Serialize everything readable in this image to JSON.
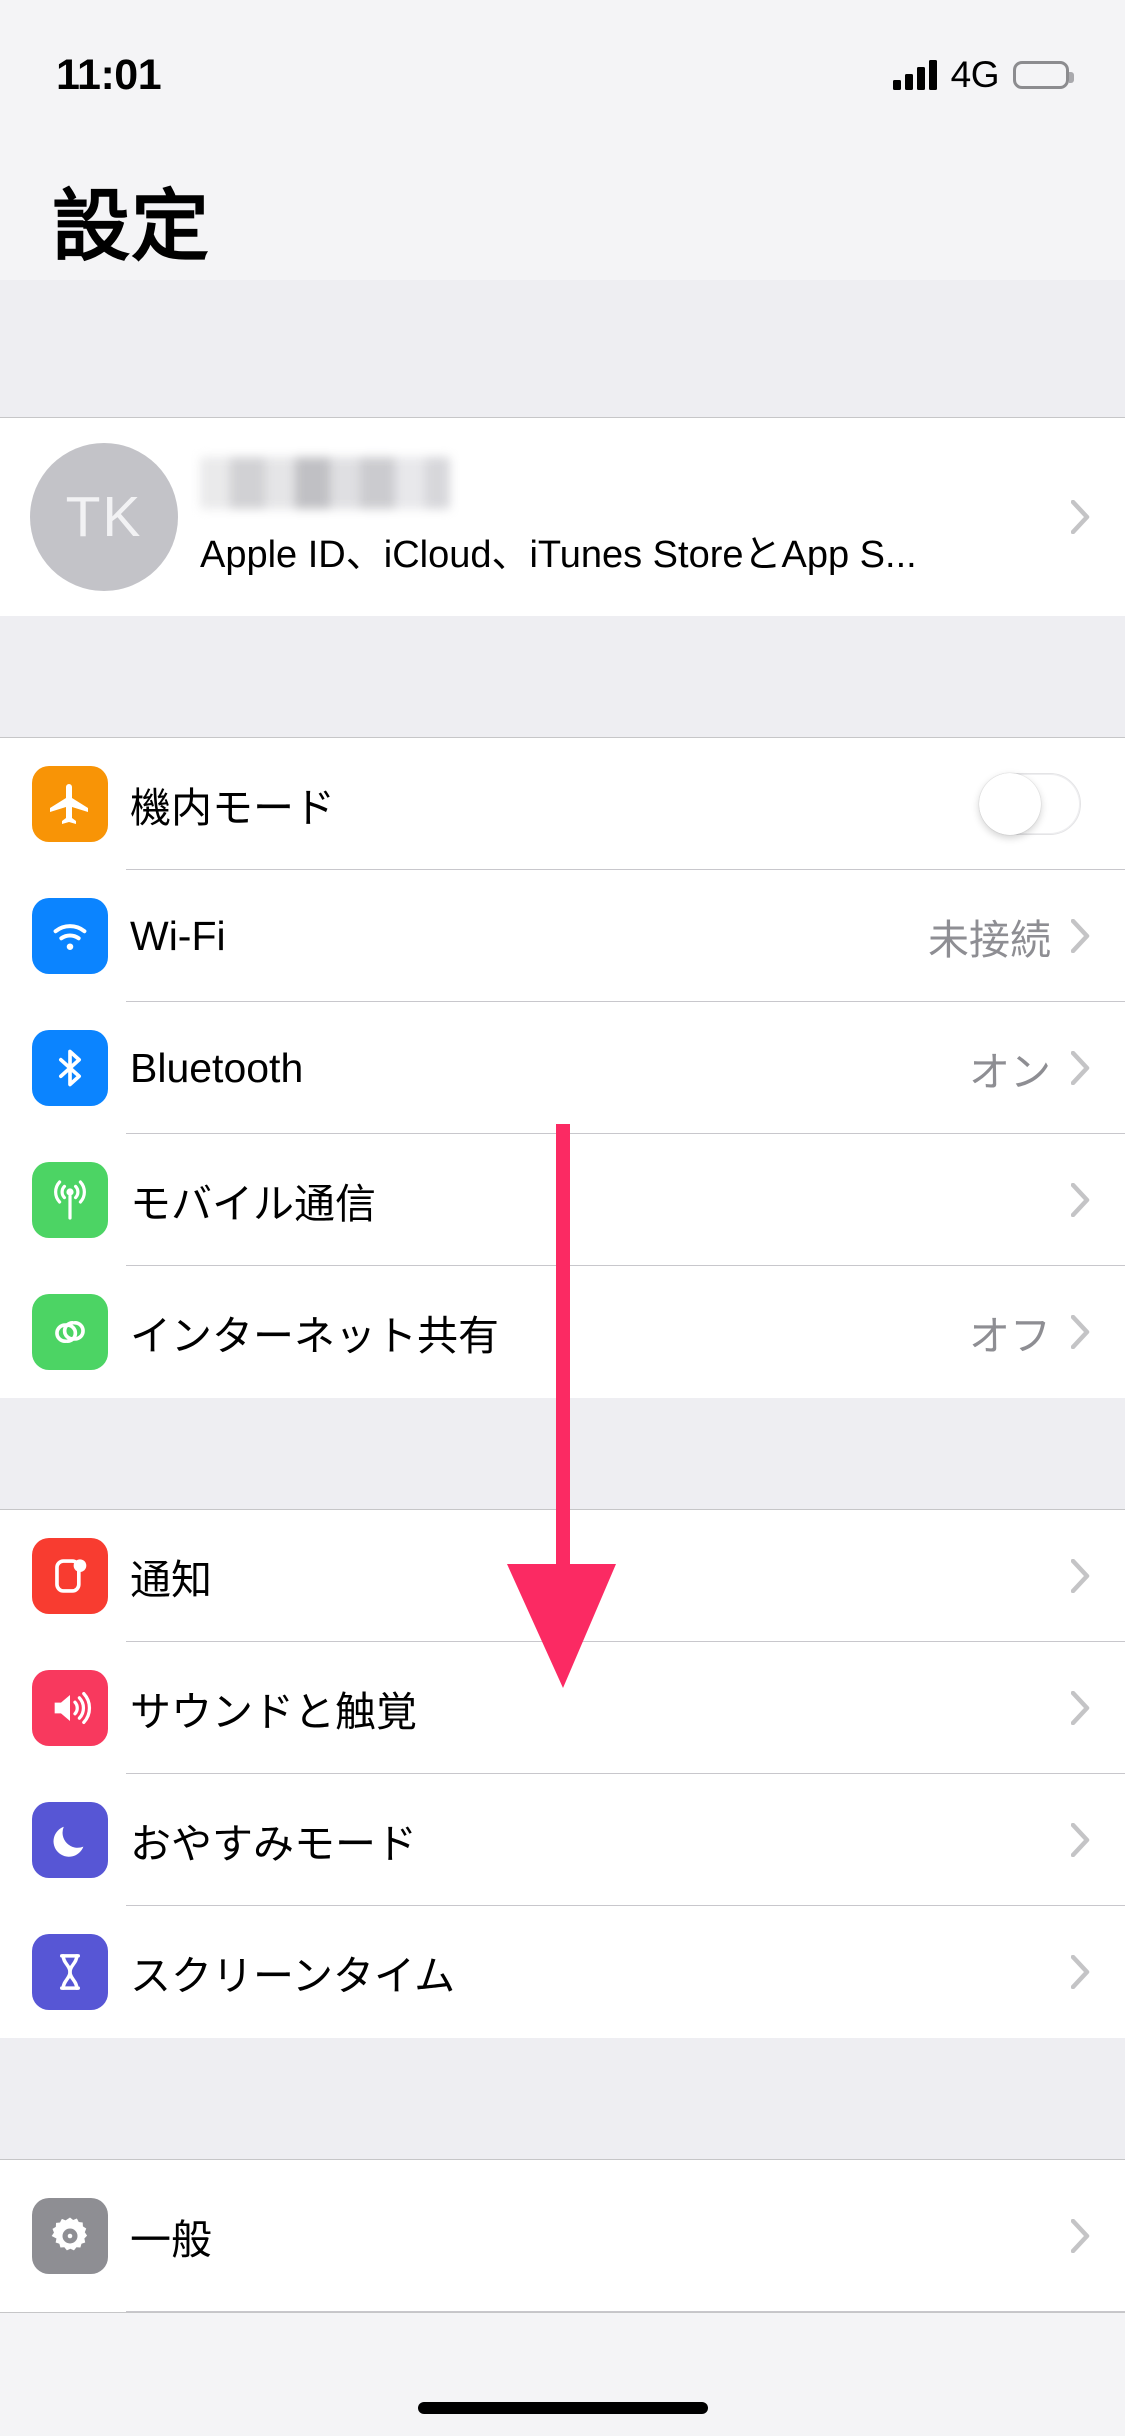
{
  "status_bar": {
    "time": "11:01",
    "carrier_network": "4G",
    "signal_icon": "signal-bars-icon",
    "battery_icon": "battery-full-icon"
  },
  "header": {
    "title": "設定"
  },
  "apple_id": {
    "avatar_initials": "TK",
    "name_redacted": true,
    "subtitle": "Apple ID、iCloud、iTunes StoreとApp S...",
    "chevron": "chevron-right-icon"
  },
  "groups": [
    {
      "id": "connectivity",
      "rows": [
        {
          "label": "機内モード",
          "icon": "airplane-icon",
          "icon_color": "#f89406",
          "accessory": "toggle",
          "toggle_on": false,
          "value": ""
        },
        {
          "label": "Wi-Fi",
          "icon": "wifi-icon",
          "icon_color": "#0b84ff",
          "accessory": "chevron",
          "value": "未接続"
        },
        {
          "label": "Bluetooth",
          "icon": "bluetooth-icon",
          "icon_color": "#0b84ff",
          "accessory": "chevron",
          "value": "オン"
        },
        {
          "label": "モバイル通信",
          "icon": "cellular-antenna-icon",
          "icon_color": "#4cd464",
          "accessory": "chevron",
          "value": ""
        },
        {
          "label": "インターネット共有",
          "icon": "personal-hotspot-icon",
          "icon_color": "#4cd464",
          "accessory": "chevron",
          "value": "オフ"
        }
      ]
    },
    {
      "id": "alerts",
      "rows": [
        {
          "label": "通知",
          "icon": "notifications-icon",
          "icon_color": "#f83c30",
          "accessory": "chevron",
          "value": ""
        },
        {
          "label": "サウンドと触覚",
          "icon": "sounds-speaker-icon",
          "icon_color": "#f8395e",
          "accessory": "chevron",
          "value": ""
        },
        {
          "label": "おやすみモード",
          "icon": "moon-do-not-disturb-icon",
          "icon_color": "#5756d5",
          "accessory": "chevron",
          "value": ""
        },
        {
          "label": "スクリーンタイム",
          "icon": "hourglass-screentime-icon",
          "icon_color": "#5756d5",
          "accessory": "chevron",
          "value": ""
        }
      ]
    },
    {
      "id": "system",
      "rows": [
        {
          "label": "一般",
          "icon": "gear-settings-icon",
          "icon_color": "#8e8e93",
          "accessory": "chevron",
          "value": ""
        }
      ]
    }
  ],
  "annotation": {
    "type": "arrow-down",
    "color": "#fb2a63",
    "points_to": "通知"
  },
  "home_indicator": "home-indicator-bar"
}
